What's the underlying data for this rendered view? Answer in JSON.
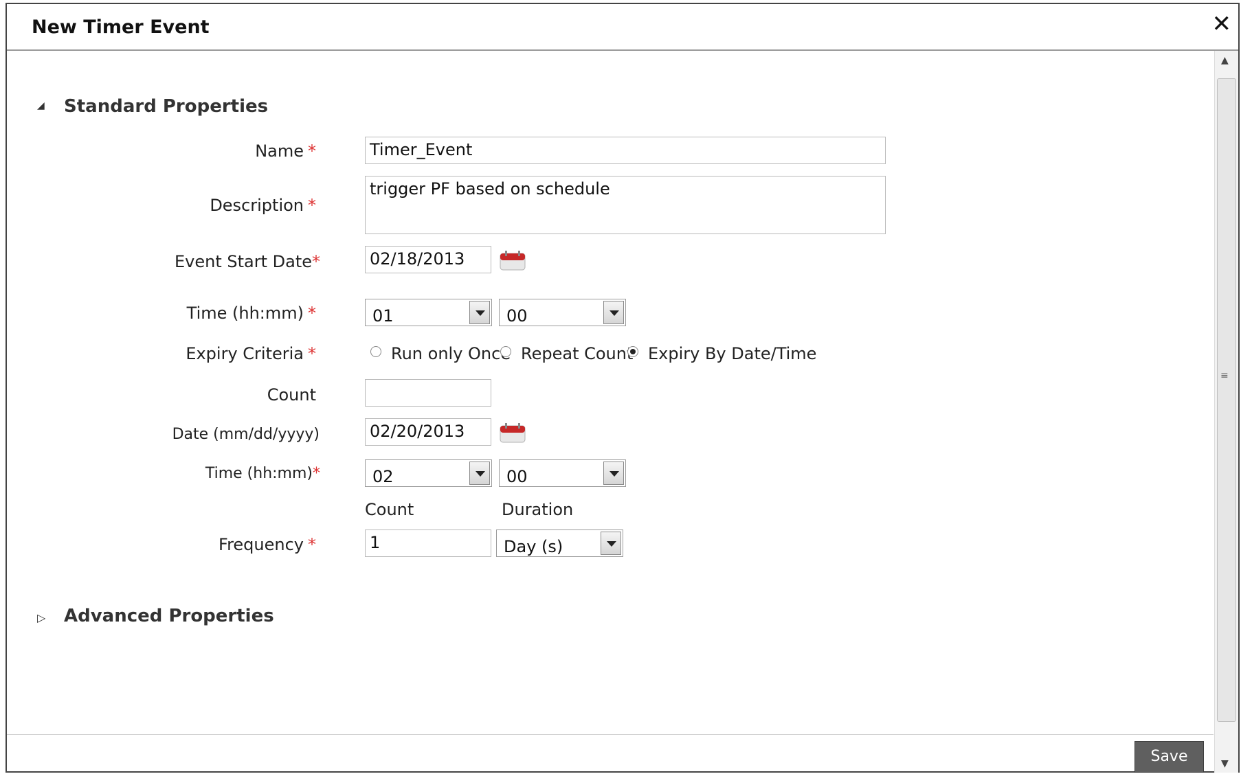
{
  "dialog": {
    "title": "New Timer Event",
    "close_glyph": "✕"
  },
  "sections": {
    "standard": {
      "label": "Standard Properties",
      "arrow": "◢"
    },
    "advanced": {
      "label": "Advanced Properties",
      "arrow": "▷"
    }
  },
  "form": {
    "name": {
      "label": "Name",
      "required": "*",
      "value": "Timer_Event"
    },
    "description": {
      "label": "Description",
      "required": "*",
      "value": "trigger PF based on schedule"
    },
    "event_start_date": {
      "label": "Event Start Date",
      "required": "*",
      "value": "02/18/2013"
    },
    "time_start": {
      "label": "Time  (hh:mm)",
      "required": "*",
      "hour": "01",
      "minute": "00"
    },
    "expiry": {
      "label": "Expiry Criteria",
      "required": "*",
      "options": [
        "Run only Once",
        "Repeat Count",
        "Expiry By Date/Time"
      ],
      "selected": "Expiry By Date/Time"
    },
    "count": {
      "label": "Count",
      "value": ""
    },
    "date": {
      "label": "Date (mm/dd/yyyy)",
      "value": "02/20/2013"
    },
    "time_end": {
      "label": "Time (hh:mm)",
      "required": "*",
      "hour": "02",
      "minute": "00"
    },
    "frequency": {
      "label": "Frequency",
      "required": "*",
      "count_header": "Count",
      "duration_header": "Duration",
      "count_value": "1",
      "duration_value": "Day (s)"
    }
  },
  "footer": {
    "save_label": "Save"
  },
  "scrollbar": {
    "up_glyph": "▲",
    "down_glyph": "▼",
    "grip_glyph": "≡"
  },
  "icons": {
    "calendar": "calendar-icon"
  },
  "colors": {
    "required": "#d33333",
    "save_button": "#5f5f5f",
    "calendar_red": "#c62828"
  }
}
